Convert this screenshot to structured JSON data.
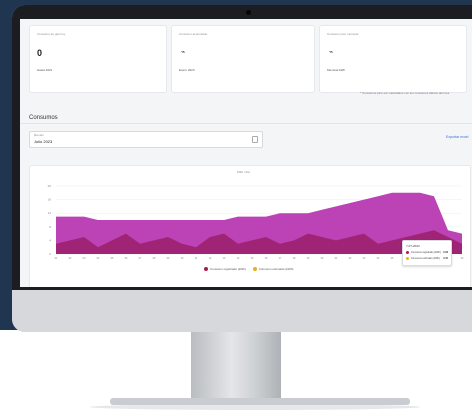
{
  "dashboard": {
    "summary_cards": [
      {
        "label": "Consumo de gas hoy",
        "value": "0",
        "sub": "Hasta 2021"
      },
      {
        "label": "Consumo acumulado",
        "value": "",
        "sub": "Enero 2023"
      },
      {
        "label": "Consumo pico mensual",
        "value": "",
        "sub": "Mensual kWh"
      }
    ],
    "footnote": "* Consumos pico son calculados con los consumos diarios del mes",
    "section_title": "Consumos",
    "month_field": {
      "label": "Mes año",
      "value": "Julio 2023"
    },
    "export_label": "Exportar excel",
    "chart_title": "kWh / día",
    "tooltip": {
      "title": "7-07-2023",
      "rows": [
        {
          "label": "Consumo registrado (kWh)",
          "value": "9.68"
        },
        {
          "label": "Consumo estimado (kWh)",
          "value": "3.35"
        }
      ]
    },
    "legend": [
      {
        "label": "Consumo registrado (kWh)",
        "color": "#a8204a"
      },
      {
        "label": "Consumo estimado (kWh)",
        "color": "#e6b020"
      }
    ]
  },
  "colors": {
    "frame_bg": "#1f3550",
    "estimated_fill": "#b52fae",
    "registered_fill": "#9a1f6a",
    "accent_link": "#3a6fd8"
  },
  "chart_data": {
    "type": "area",
    "x": [
      "01",
      "02",
      "03",
      "04",
      "05",
      "06",
      "07",
      "08",
      "09",
      "10",
      "11",
      "12",
      "13",
      "14",
      "15",
      "16",
      "17",
      "18",
      "19",
      "20",
      "21",
      "22",
      "23",
      "24",
      "25",
      "26",
      "27",
      "28",
      "29",
      "30"
    ],
    "ylim": [
      0,
      20
    ],
    "yticks": [
      "20",
      "16",
      "12",
      "8",
      "4",
      "0"
    ],
    "series": [
      {
        "name": "Consumo estimado (kWh)",
        "values": [
          11,
          11,
          11,
          10,
          10,
          10,
          10,
          10,
          10,
          10,
          10,
          10,
          10,
          11,
          11,
          11,
          12,
          12,
          12,
          13,
          14,
          15,
          16,
          17,
          18,
          18,
          18,
          17,
          7,
          6
        ]
      },
      {
        "name": "Consumo registrado (kWh)",
        "values": [
          3,
          4,
          5,
          2,
          4,
          6,
          3,
          4,
          5,
          3,
          2,
          5,
          6,
          3,
          4,
          5,
          3,
          4,
          6,
          5,
          4,
          5,
          6,
          3,
          4,
          5,
          6,
          7,
          5,
          3
        ]
      }
    ]
  }
}
